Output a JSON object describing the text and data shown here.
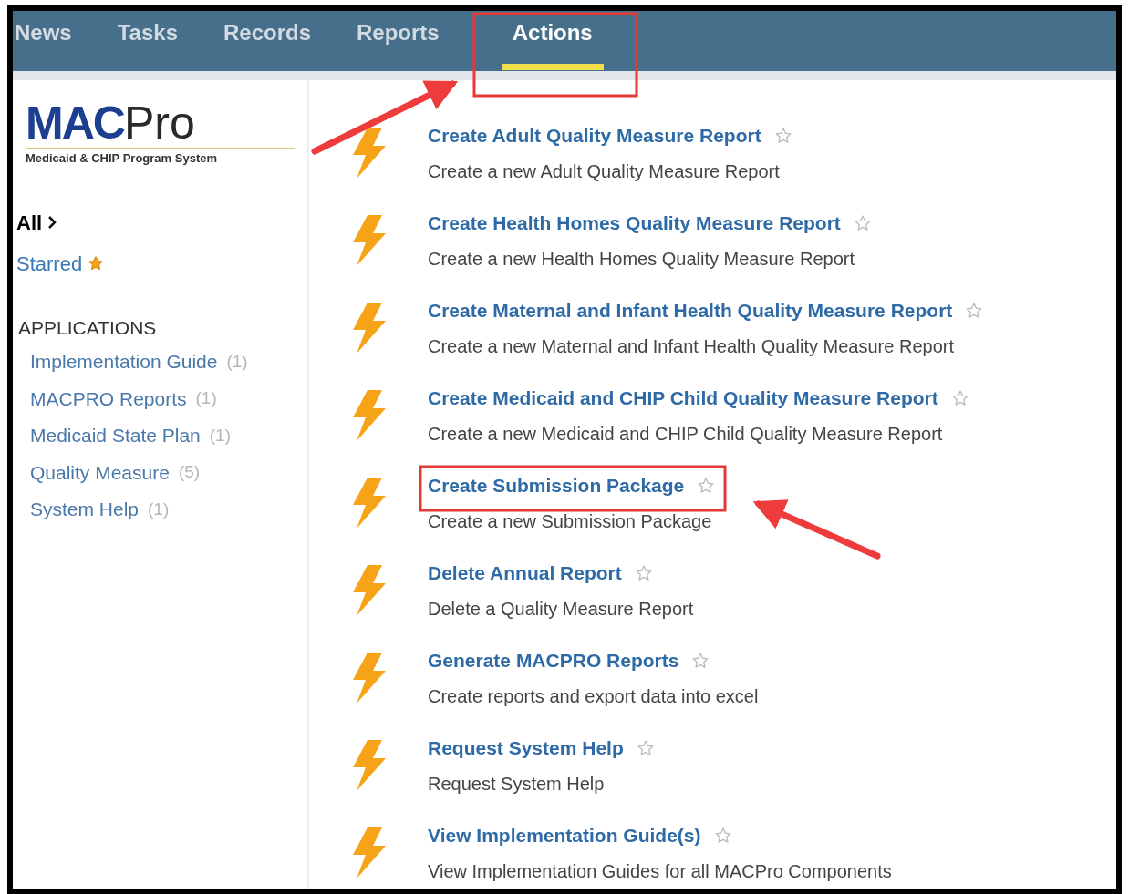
{
  "nav": {
    "tabs": [
      {
        "label": "News",
        "selected": false
      },
      {
        "label": "Tasks",
        "selected": false
      },
      {
        "label": "Records",
        "selected": false
      },
      {
        "label": "Reports",
        "selected": false
      },
      {
        "label": "Actions",
        "selected": true
      }
    ]
  },
  "logo": {
    "brand_bold": "MAC",
    "brand_light": "Pro",
    "tagline": "Medicaid & CHIP Program System"
  },
  "sidebar": {
    "all": "All",
    "starred": "Starred",
    "section": "APPLICATIONS",
    "items": [
      {
        "label": "Implementation Guide",
        "count": "(1)"
      },
      {
        "label": "MACPRO Reports",
        "count": "(1)"
      },
      {
        "label": "Medicaid State Plan",
        "count": "(1)"
      },
      {
        "label": "Quality Measure",
        "count": "(5)"
      },
      {
        "label": "System Help",
        "count": "(1)"
      }
    ]
  },
  "actions": [
    {
      "title": "Create Adult Quality Measure Report",
      "description": "Create a new Adult Quality Measure Report",
      "starred": false
    },
    {
      "title": "Create Health Homes Quality Measure Report",
      "description": "Create a new Health Homes Quality Measure Report",
      "starred": false
    },
    {
      "title": "Create Maternal and Infant Health Quality Measure Report",
      "description": "Create a new Maternal and Infant Health Quality Measure Report",
      "starred": false
    },
    {
      "title": "Create Medicaid and CHIP Child Quality Measure Report",
      "description": "Create a new Medicaid and CHIP Child Quality Measure Report",
      "starred": false
    },
    {
      "title": "Create Submission Package",
      "description": "Create a new Submission Package",
      "starred": false
    },
    {
      "title": "Delete Annual Report",
      "description": "Delete a Quality Measure Report",
      "starred": false
    },
    {
      "title": "Generate MACPRO Reports",
      "description": "Create reports and export data into excel",
      "starred": false
    },
    {
      "title": "Request System Help",
      "description": "Request System Help",
      "starred": false
    },
    {
      "title": "View Implementation Guide(s)",
      "description": "View Implementation Guides for all MACPro Components",
      "starred": false
    }
  ]
}
